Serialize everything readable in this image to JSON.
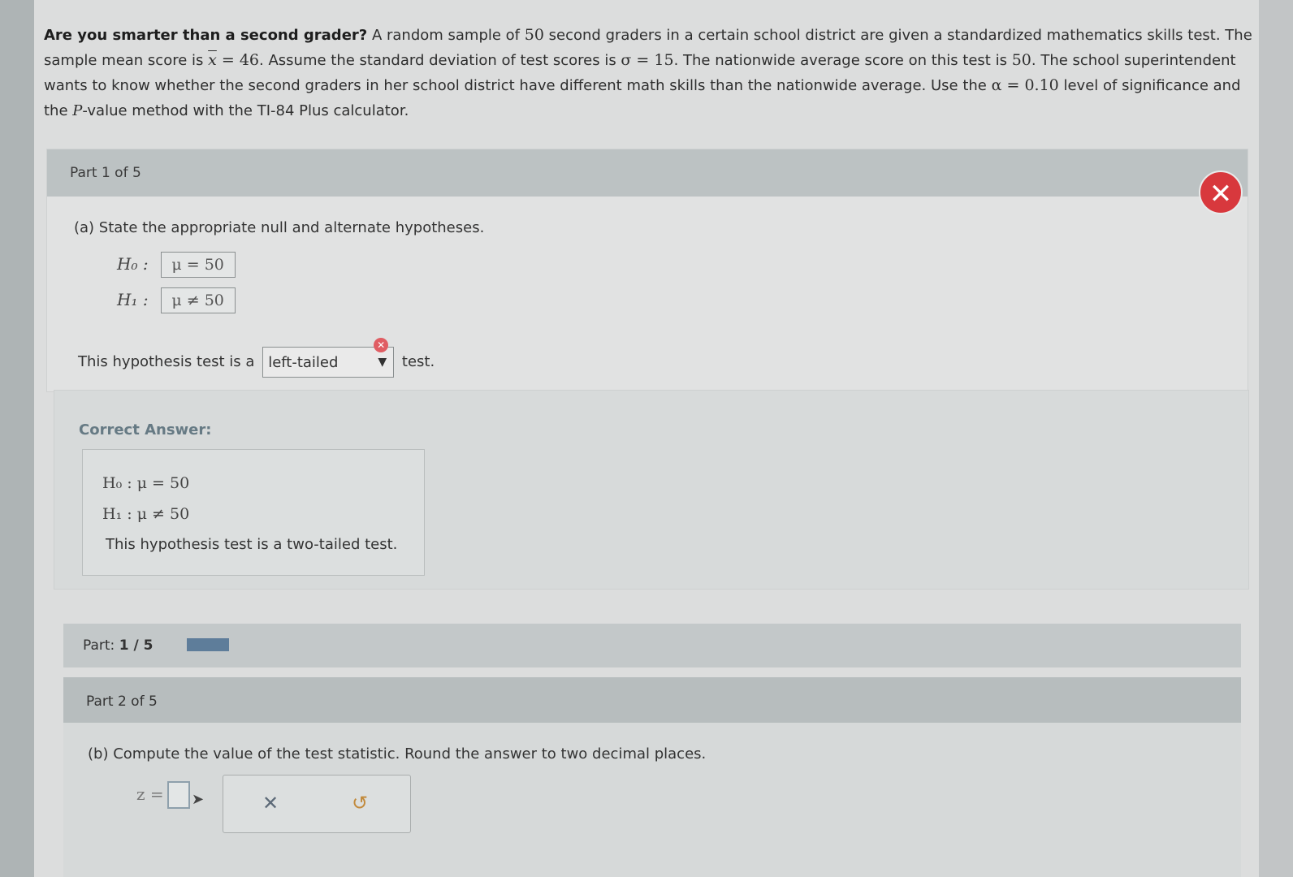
{
  "problem": {
    "bold_lead": "Are you smarter than a second grader?",
    "seg1": " A random sample of ",
    "n": "50",
    "seg2": " second graders in a certain school district are given a standardized mathematics skills test. The sample mean score is ",
    "xbar_symbol": "x",
    "xbar_value": " = 46",
    "seg3": ". Assume the standard deviation of test scores is ",
    "sigma": "σ = 15",
    "seg4": ". The nationwide average score on this test is ",
    "nat_avg": "50",
    "seg5": ". The school superintendent wants to know whether the second graders in her school district have different math skills than the nationwide average. Use the ",
    "alpha": "α = 0.10",
    "seg6": " level of significance and the ",
    "p_letter": "P",
    "seg7": "-value method with the TI-84 Plus calculator."
  },
  "part1": {
    "label": "Part 1 of 5",
    "question": "(a) State the appropriate null and alternate hypotheses.",
    "h0_label": "H₀ :",
    "h0_value": "μ = 50",
    "h1_label": "H₁ :",
    "h1_value": "μ ≠ 50",
    "tail_prefix": "This hypothesis test is a",
    "tail_selected": "left-tailed",
    "tail_suffix": "test.",
    "close_icon": "✕"
  },
  "correct": {
    "title": "Correct Answer:",
    "h0": "H₀ : μ = 50",
    "h1": "H₁ : μ ≠ 50",
    "text": "This hypothesis test is a two-tailed test."
  },
  "progress": {
    "prefix": "Part: ",
    "current": "1",
    "sep": " / ",
    "total": "5",
    "fraction": 0.2
  },
  "part2": {
    "label": "Part 2 of 5",
    "question": "(b) Compute the value of the test statistic. Round the answer to two decimal places.",
    "z_label": "z =",
    "clear_icon": "✕",
    "undo_icon": "↺"
  },
  "colors": {
    "close_button": "#d8383d",
    "correct_title": "#667a84",
    "progress_fill": "#5e7d9a"
  }
}
